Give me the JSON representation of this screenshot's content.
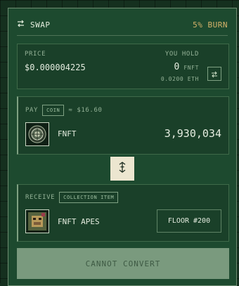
{
  "header": {
    "title": "SWAP",
    "burn": "5% BURN",
    "icon": "swap-arrows-icon"
  },
  "price": {
    "label": "PRICE",
    "value": "$0.000004225",
    "hold_label": "YOU HOLD",
    "hold_amount": "0",
    "hold_token": "FNFT",
    "hold_eth": "0.0200 ETH"
  },
  "pay": {
    "label": "PAY",
    "tag": "COIN",
    "approx": "≈ $16.60",
    "token": "FNFT",
    "amount": "3,930,034"
  },
  "receive": {
    "label": "RECEIVE",
    "tag": "COLLECTION ITEM",
    "name": "FNFT APES",
    "floor": "FLOOR #200"
  },
  "action": {
    "label": "CANNOT CONVERT",
    "enabled": false
  },
  "colors": {
    "accent": "#d7b36a",
    "panel": "#1d4a2f",
    "button_disabled": "#7a9a7e"
  }
}
